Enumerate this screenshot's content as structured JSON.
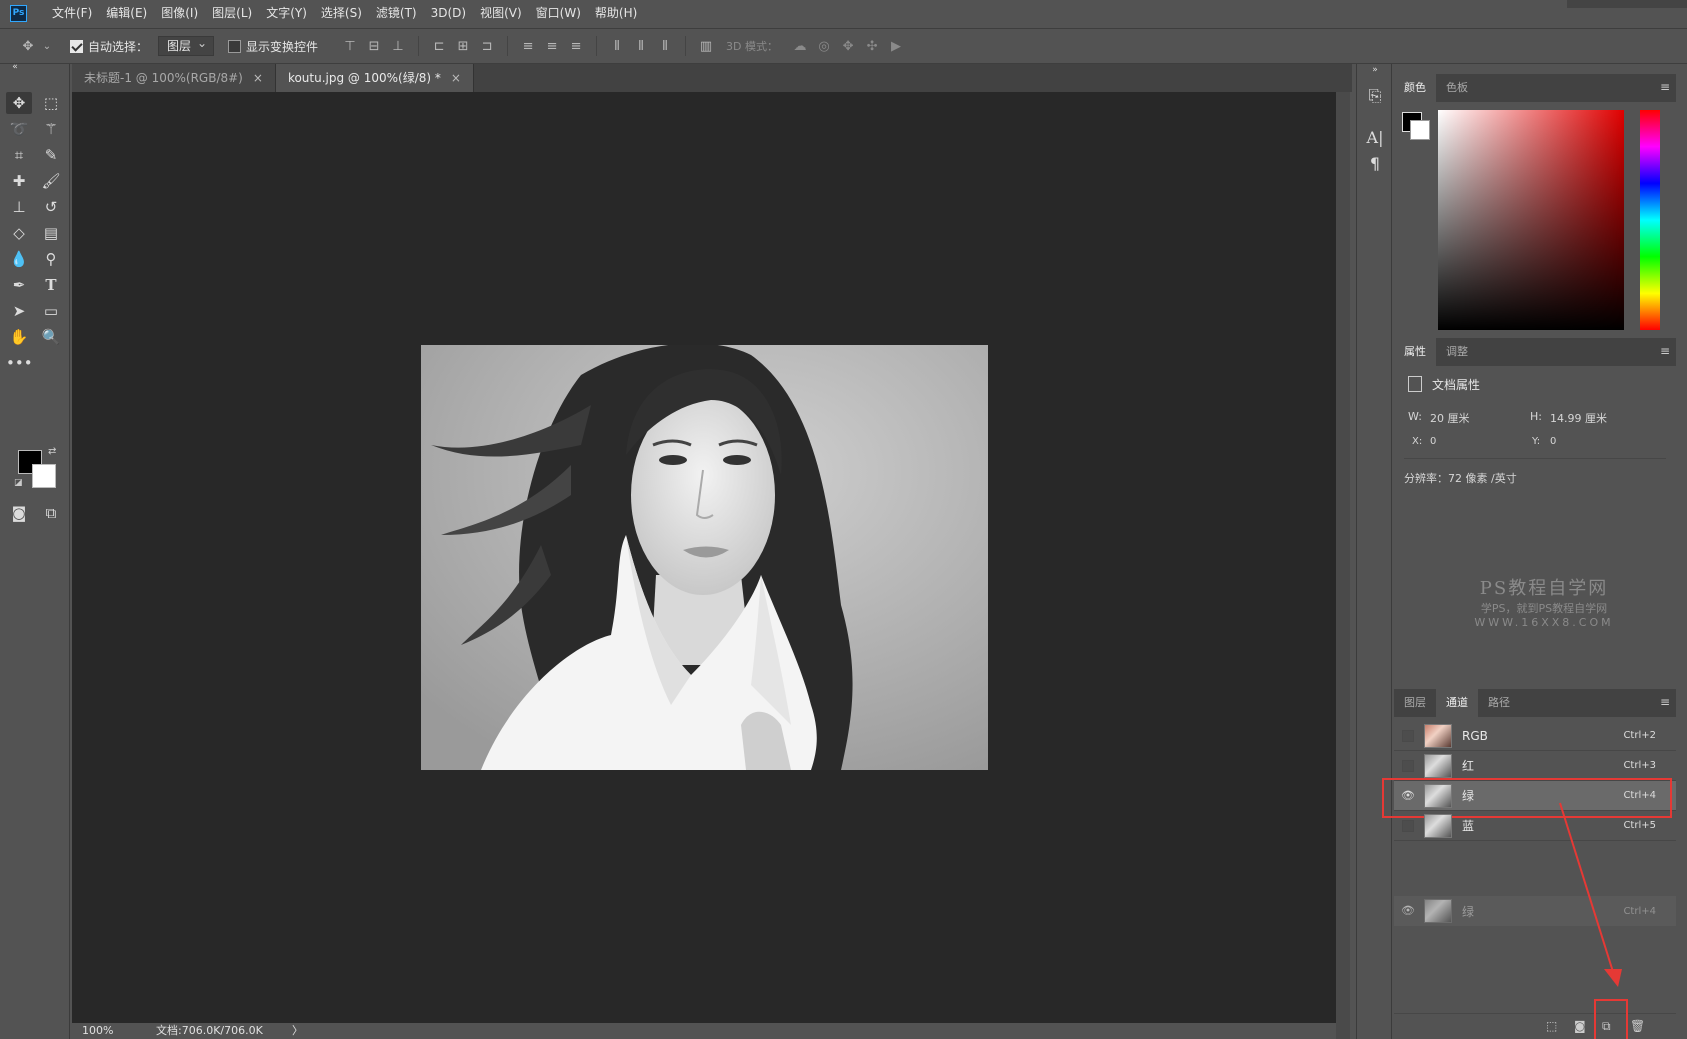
{
  "app": {
    "logo": "Ps"
  },
  "menu": [
    "文件(F)",
    "编辑(E)",
    "图像(I)",
    "图层(L)",
    "文字(Y)",
    "选择(S)",
    "滤镜(T)",
    "3D(D)",
    "视图(V)",
    "窗口(W)",
    "帮助(H)"
  ],
  "options": {
    "auto_select_label": "自动选择：",
    "auto_select_value": "图层",
    "show_transform_label": "显示变换控件",
    "mode_3d_label": "3D 模式："
  },
  "tabs": [
    {
      "label": "未标题-1 @ 100%(RGB/8#)",
      "active": false
    },
    {
      "label": "koutu.jpg @ 100%(绿/8) *",
      "active": true
    }
  ],
  "status": {
    "zoom": "100%",
    "doc_info": "文档:706.0K/706.0K",
    "arrow": "〉"
  },
  "color_panel": {
    "tabs": [
      "颜色",
      "色板"
    ]
  },
  "properties_panel": {
    "tabs": [
      "属性",
      "调整"
    ],
    "heading": "文档属性",
    "w_label": "W:",
    "w_value": "20 厘米",
    "h_label": "H:",
    "h_value": "14.99 厘米",
    "x_label": "X:",
    "x_value": "0",
    "y_label": "Y:",
    "y_value": "0",
    "resolution": "分辨率：72 像素 /英寸"
  },
  "watermark": {
    "line1": "PS教程自学网",
    "line2": "学PS，就到PS教程自学网",
    "line3": "WWW.16XX8.COM"
  },
  "channels_panel": {
    "tabs": [
      "图层",
      "通道",
      "路径"
    ],
    "rows": [
      {
        "name": "RGB",
        "key": "Ctrl+2",
        "visible": false
      },
      {
        "name": "红",
        "key": "Ctrl+3",
        "visible": false
      },
      {
        "name": "绿",
        "key": "Ctrl+4",
        "visible": true
      },
      {
        "name": "蓝",
        "key": "Ctrl+5",
        "visible": false
      }
    ],
    "drag_row": {
      "name": "绿",
      "key": "Ctrl+4"
    }
  },
  "colors": {
    "highlight": "#e53935",
    "panel_bg": "#535353",
    "canvas_bg": "#282828"
  }
}
